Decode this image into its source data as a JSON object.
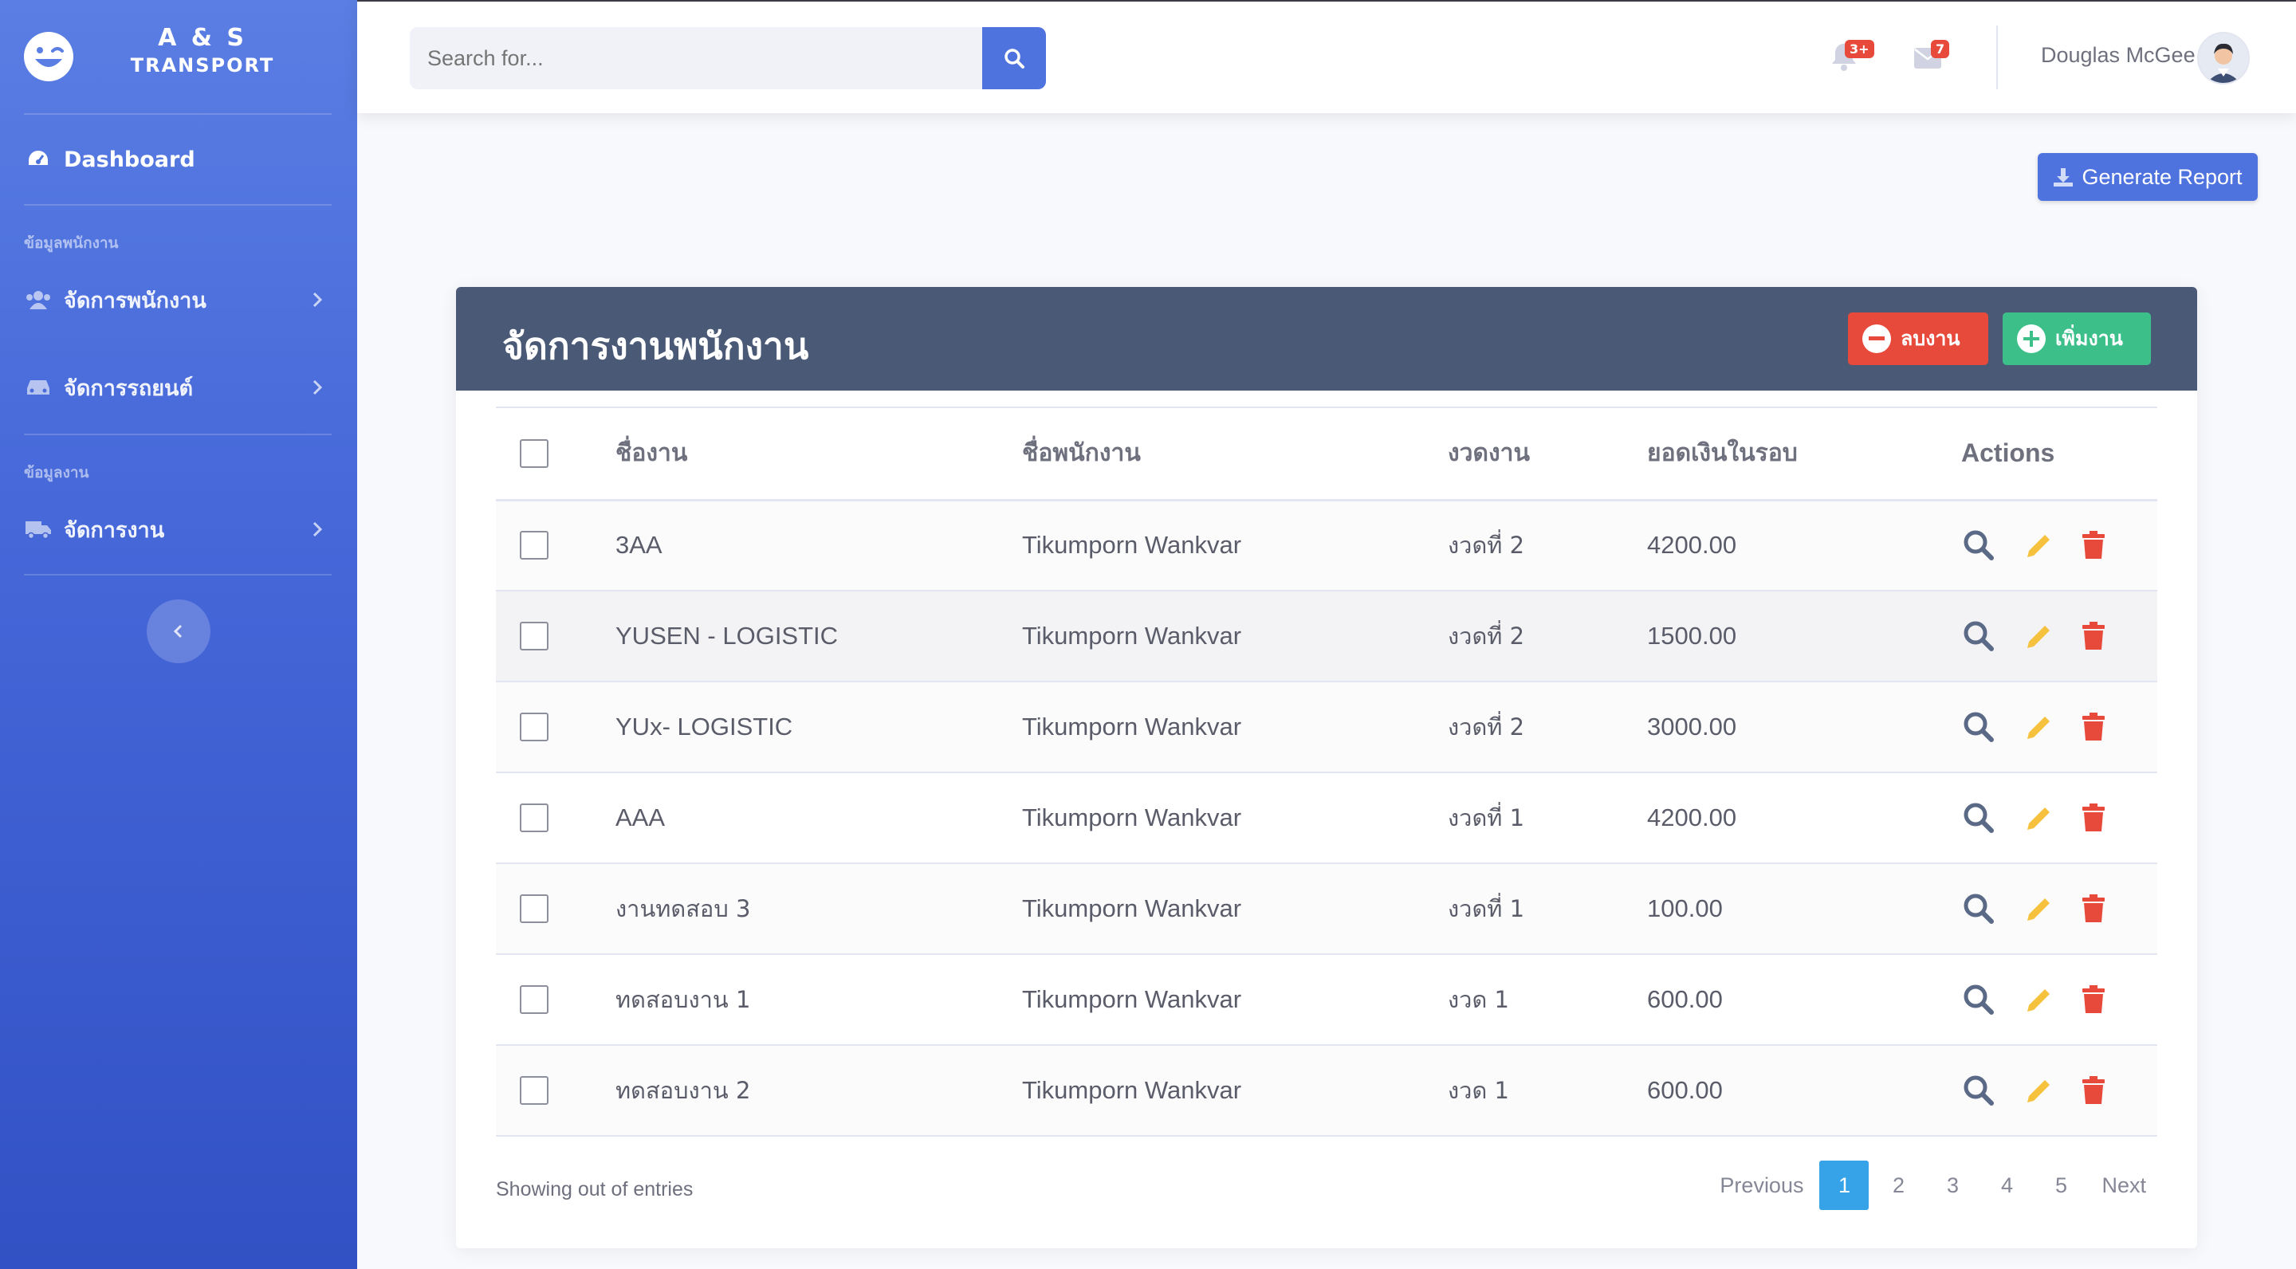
{
  "brand": {
    "line1": "A & S",
    "line2": "TRANSPORT"
  },
  "sidebar": {
    "dashboard": "Dashboard",
    "heading_employee": "ข้อมูลพนักงาน",
    "manage_employee": "จัดการพนักงาน",
    "manage_vehicle": "จัดการรถยนต์",
    "heading_work": "ข้อมูลงาน",
    "manage_work": "จัดการงาน"
  },
  "topbar": {
    "search_placeholder": "Search for...",
    "alerts_badge": "3+",
    "messages_badge": "7",
    "user_name": "Douglas McGee"
  },
  "main": {
    "generate_report": "Generate Report",
    "card_title": "จัดการงานพนักงาน",
    "delete_button": "ลบงาน",
    "add_button": "เพิ่มงาน"
  },
  "table": {
    "columns": [
      "ชื่องาน",
      "ชื่อพนักงาน",
      "งวดงาน",
      "ยอดเงินในรอบ",
      "Actions"
    ],
    "rows": [
      [
        "3AA",
        "Tikumporn Wankvar",
        "งวดที่ 2",
        "4200.00"
      ],
      [
        "YUSEN - LOGISTIC",
        "Tikumporn Wankvar",
        "งวดที่ 2",
        "1500.00"
      ],
      [
        "YUx- LOGISTIC",
        "Tikumporn Wankvar",
        "งวดที่ 2",
        "3000.00"
      ],
      [
        "AAA",
        "Tikumporn Wankvar",
        "งวดที่ 1",
        "4200.00"
      ],
      [
        "งานทดสอบ 3",
        "Tikumporn Wankvar",
        "งวดที่ 1",
        "100.00"
      ],
      [
        "ทดสอบงาน 1",
        "Tikumporn Wankvar",
        "งวด 1",
        "600.00"
      ],
      [
        "ทดสอบงาน 2",
        "Tikumporn Wankvar",
        "งวด 1",
        "600.00"
      ]
    ]
  },
  "footer": {
    "showing": "Showing out of entries",
    "pagination": {
      "previous": "Previous",
      "pages": [
        "1",
        "2",
        "3",
        "4",
        "5"
      ],
      "next": "Next",
      "current": "1"
    }
  },
  "colors": {
    "primary": "#4e73df",
    "danger": "#e74a3b",
    "success": "#3dbf8a",
    "warning": "#f6c23e",
    "header": "#4a5a76"
  }
}
